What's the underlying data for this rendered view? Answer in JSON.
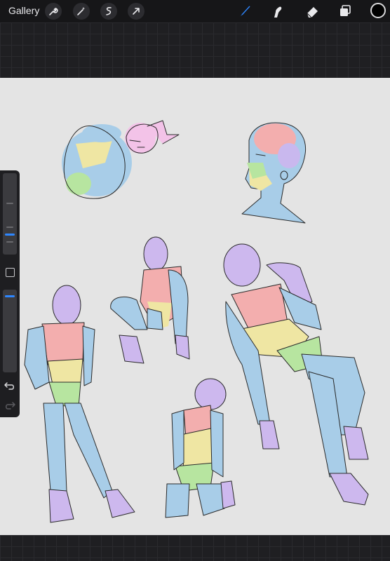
{
  "topbar": {
    "gallery_label": "Gallery",
    "left_tools": [
      "wrench-icon",
      "magic-wand-icon",
      "selection-icon",
      "transform-arrow-icon"
    ],
    "right_tools": [
      "brush-icon",
      "smudge-icon",
      "eraser-icon",
      "layers-icon"
    ],
    "active_tool": "brush-icon",
    "current_color": "#000000",
    "accent_color": "#2e87ff"
  },
  "sidebar": {
    "brush_size_level": 0.33,
    "opacity_level": 0.94,
    "controls": [
      "brush-size-slider",
      "modify-button",
      "opacity-slider",
      "undo-icon",
      "redo-icon"
    ]
  },
  "canvas": {
    "background": "#e4e4e4",
    "artwork": "figure-pose-sketches"
  }
}
